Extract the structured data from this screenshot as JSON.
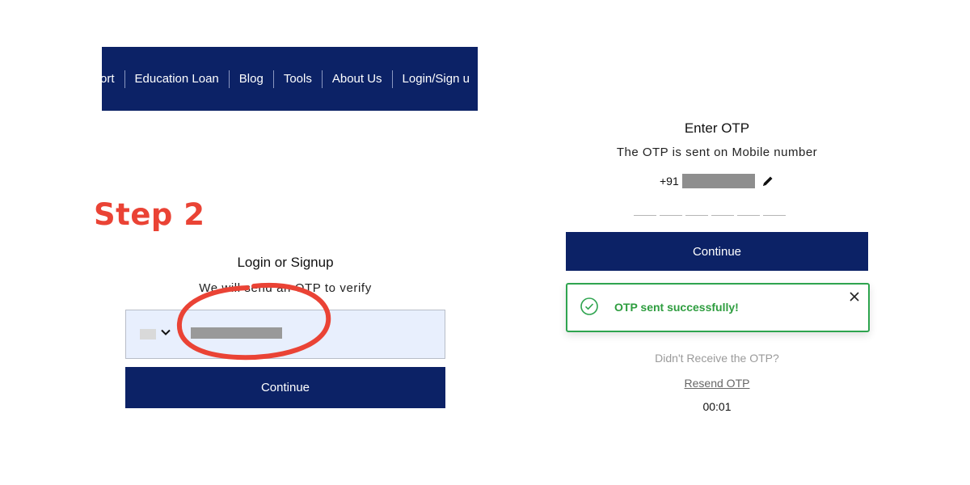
{
  "nav": {
    "items": [
      {
        "label": "ort"
      },
      {
        "label": "Education Loan"
      },
      {
        "label": "Blog"
      },
      {
        "label": "Tools"
      },
      {
        "label": "About Us"
      },
      {
        "label": "Login/Sign u"
      }
    ],
    "background": "#0c2266"
  },
  "annotation": {
    "step_label": "Step 2",
    "step_color": "#ea4335"
  },
  "login": {
    "title": "Login or Signup",
    "subtitle": "We will send an OTP to verify",
    "continue_label": "Continue"
  },
  "otp": {
    "title": "Enter OTP",
    "subtitle": "The OTP is sent on Mobile number",
    "country_code": "+91",
    "continue_label": "Continue",
    "toast_message": "OTP sent successfully!",
    "didnt_receive": "Didn't Receive the OTP?",
    "resend_label": "Resend OTP",
    "timer": "00:01",
    "success_color": "#2ea44f"
  },
  "icons": [
    "chevron-down-icon",
    "pencil-icon",
    "check-circle-icon",
    "close-icon"
  ]
}
